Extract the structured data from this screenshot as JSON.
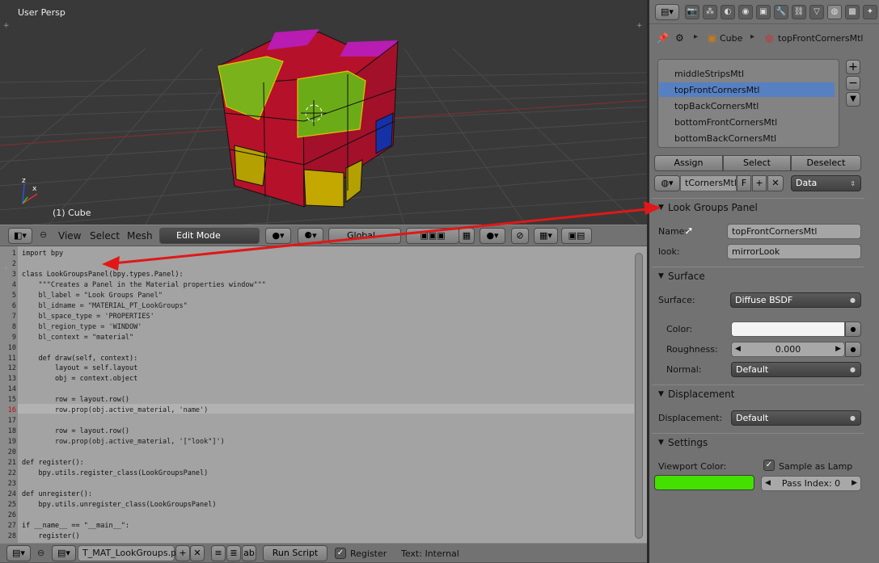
{
  "viewport": {
    "title": "User Persp",
    "object_label": "(1) Cube"
  },
  "view3d_header": {
    "menus": [
      "View",
      "Select",
      "Mesh"
    ],
    "mode": "Edit Mode",
    "orientation": "Global"
  },
  "editor": {
    "lines": [
      {
        "n": "1",
        "t": "import bpy"
      },
      {
        "n": "2",
        "t": ""
      },
      {
        "n": "3",
        "t": "class LookGroupsPanel(bpy.types.Panel):"
      },
      {
        "n": "4",
        "t": "    \"\"\"Creates a Panel in the Material properties window\"\"\""
      },
      {
        "n": "5",
        "t": "    bl_label = \"Look Groups Panel\""
      },
      {
        "n": "6",
        "t": "    bl_idname = \"MATERIAL_PT_LookGroups\""
      },
      {
        "n": "7",
        "t": "    bl_space_type = 'PROPERTIES'"
      },
      {
        "n": "8",
        "t": "    bl_region_type = 'WINDOW'"
      },
      {
        "n": "9",
        "t": "    bl_context = \"material\""
      },
      {
        "n": "10",
        "t": ""
      },
      {
        "n": "11",
        "t": "    def draw(self, context):"
      },
      {
        "n": "12",
        "t": "        layout = self.layout"
      },
      {
        "n": "13",
        "t": "        obj = context.object"
      },
      {
        "n": "14",
        "t": ""
      },
      {
        "n": "15",
        "t": "        row = layout.row()"
      },
      {
        "n": "16",
        "t": "        row.prop(obj.active_material, 'name')"
      },
      {
        "n": "17",
        "t": ""
      },
      {
        "n": "18",
        "t": "        row = layout.row()"
      },
      {
        "n": "19",
        "t": "        row.prop(obj.active_material, '[\"look\"]')"
      },
      {
        "n": "20",
        "t": ""
      },
      {
        "n": "21",
        "t": "def register():"
      },
      {
        "n": "22",
        "t": "    bpy.utils.register_class(LookGroupsPanel)"
      },
      {
        "n": "23",
        "t": ""
      },
      {
        "n": "24",
        "t": "def unregister():"
      },
      {
        "n": "25",
        "t": "    bpy.utils.unregister_class(LookGroupsPanel)"
      },
      {
        "n": "26",
        "t": ""
      },
      {
        "n": "27",
        "t": "if __name__ == \"__main__\":"
      },
      {
        "n": "28",
        "t": "    register()"
      }
    ]
  },
  "text_header": {
    "filename": "T_MAT_LookGroups.py",
    "run_script": "Run Script",
    "register_label": "Register",
    "register_checked": true,
    "text_status": "Text: Internal"
  },
  "properties": {
    "breadcrumb": {
      "object": "Cube",
      "material": "topFrontCornersMtl"
    },
    "material_slots": [
      "middleStripsMtl",
      "topFrontCornersMtl",
      "topBackCornersMtl",
      "bottomFrontCornersMtl",
      "bottomBackCornersMtl"
    ],
    "selected_slot": "topFrontCornersMtl",
    "slot_buttons": {
      "assign": "Assign",
      "select": "Select",
      "deselect": "Deselect"
    },
    "material_field": "tCornersMtl",
    "fake_user": "F",
    "link_mode": "Data",
    "look_groups": {
      "title": "Look Groups Panel",
      "name_label": "Name:",
      "name_value": "topFrontCornersMtl",
      "look_label": "look:",
      "look_value": "mirrorLook"
    },
    "surface": {
      "title": "Surface",
      "surface_label": "Surface:",
      "surface_value": "Diffuse BSDF",
      "color_label": "Color:",
      "roughness_label": "Roughness:",
      "roughness_value": "0.000",
      "normal_label": "Normal:",
      "normal_value": "Default"
    },
    "displacement": {
      "title": "Displacement",
      "label": "Displacement:",
      "value": "Default"
    },
    "settings": {
      "title": "Settings",
      "viewport_color_label": "Viewport Color:",
      "viewport_color": "#44e000",
      "sample_as_lamp": "Sample as Lamp",
      "sample_checked": true,
      "pass_index": "Pass Index: 0"
    }
  },
  "colors": {
    "accent_select": "#5680c2",
    "annotation_arrow": "#e02020"
  }
}
